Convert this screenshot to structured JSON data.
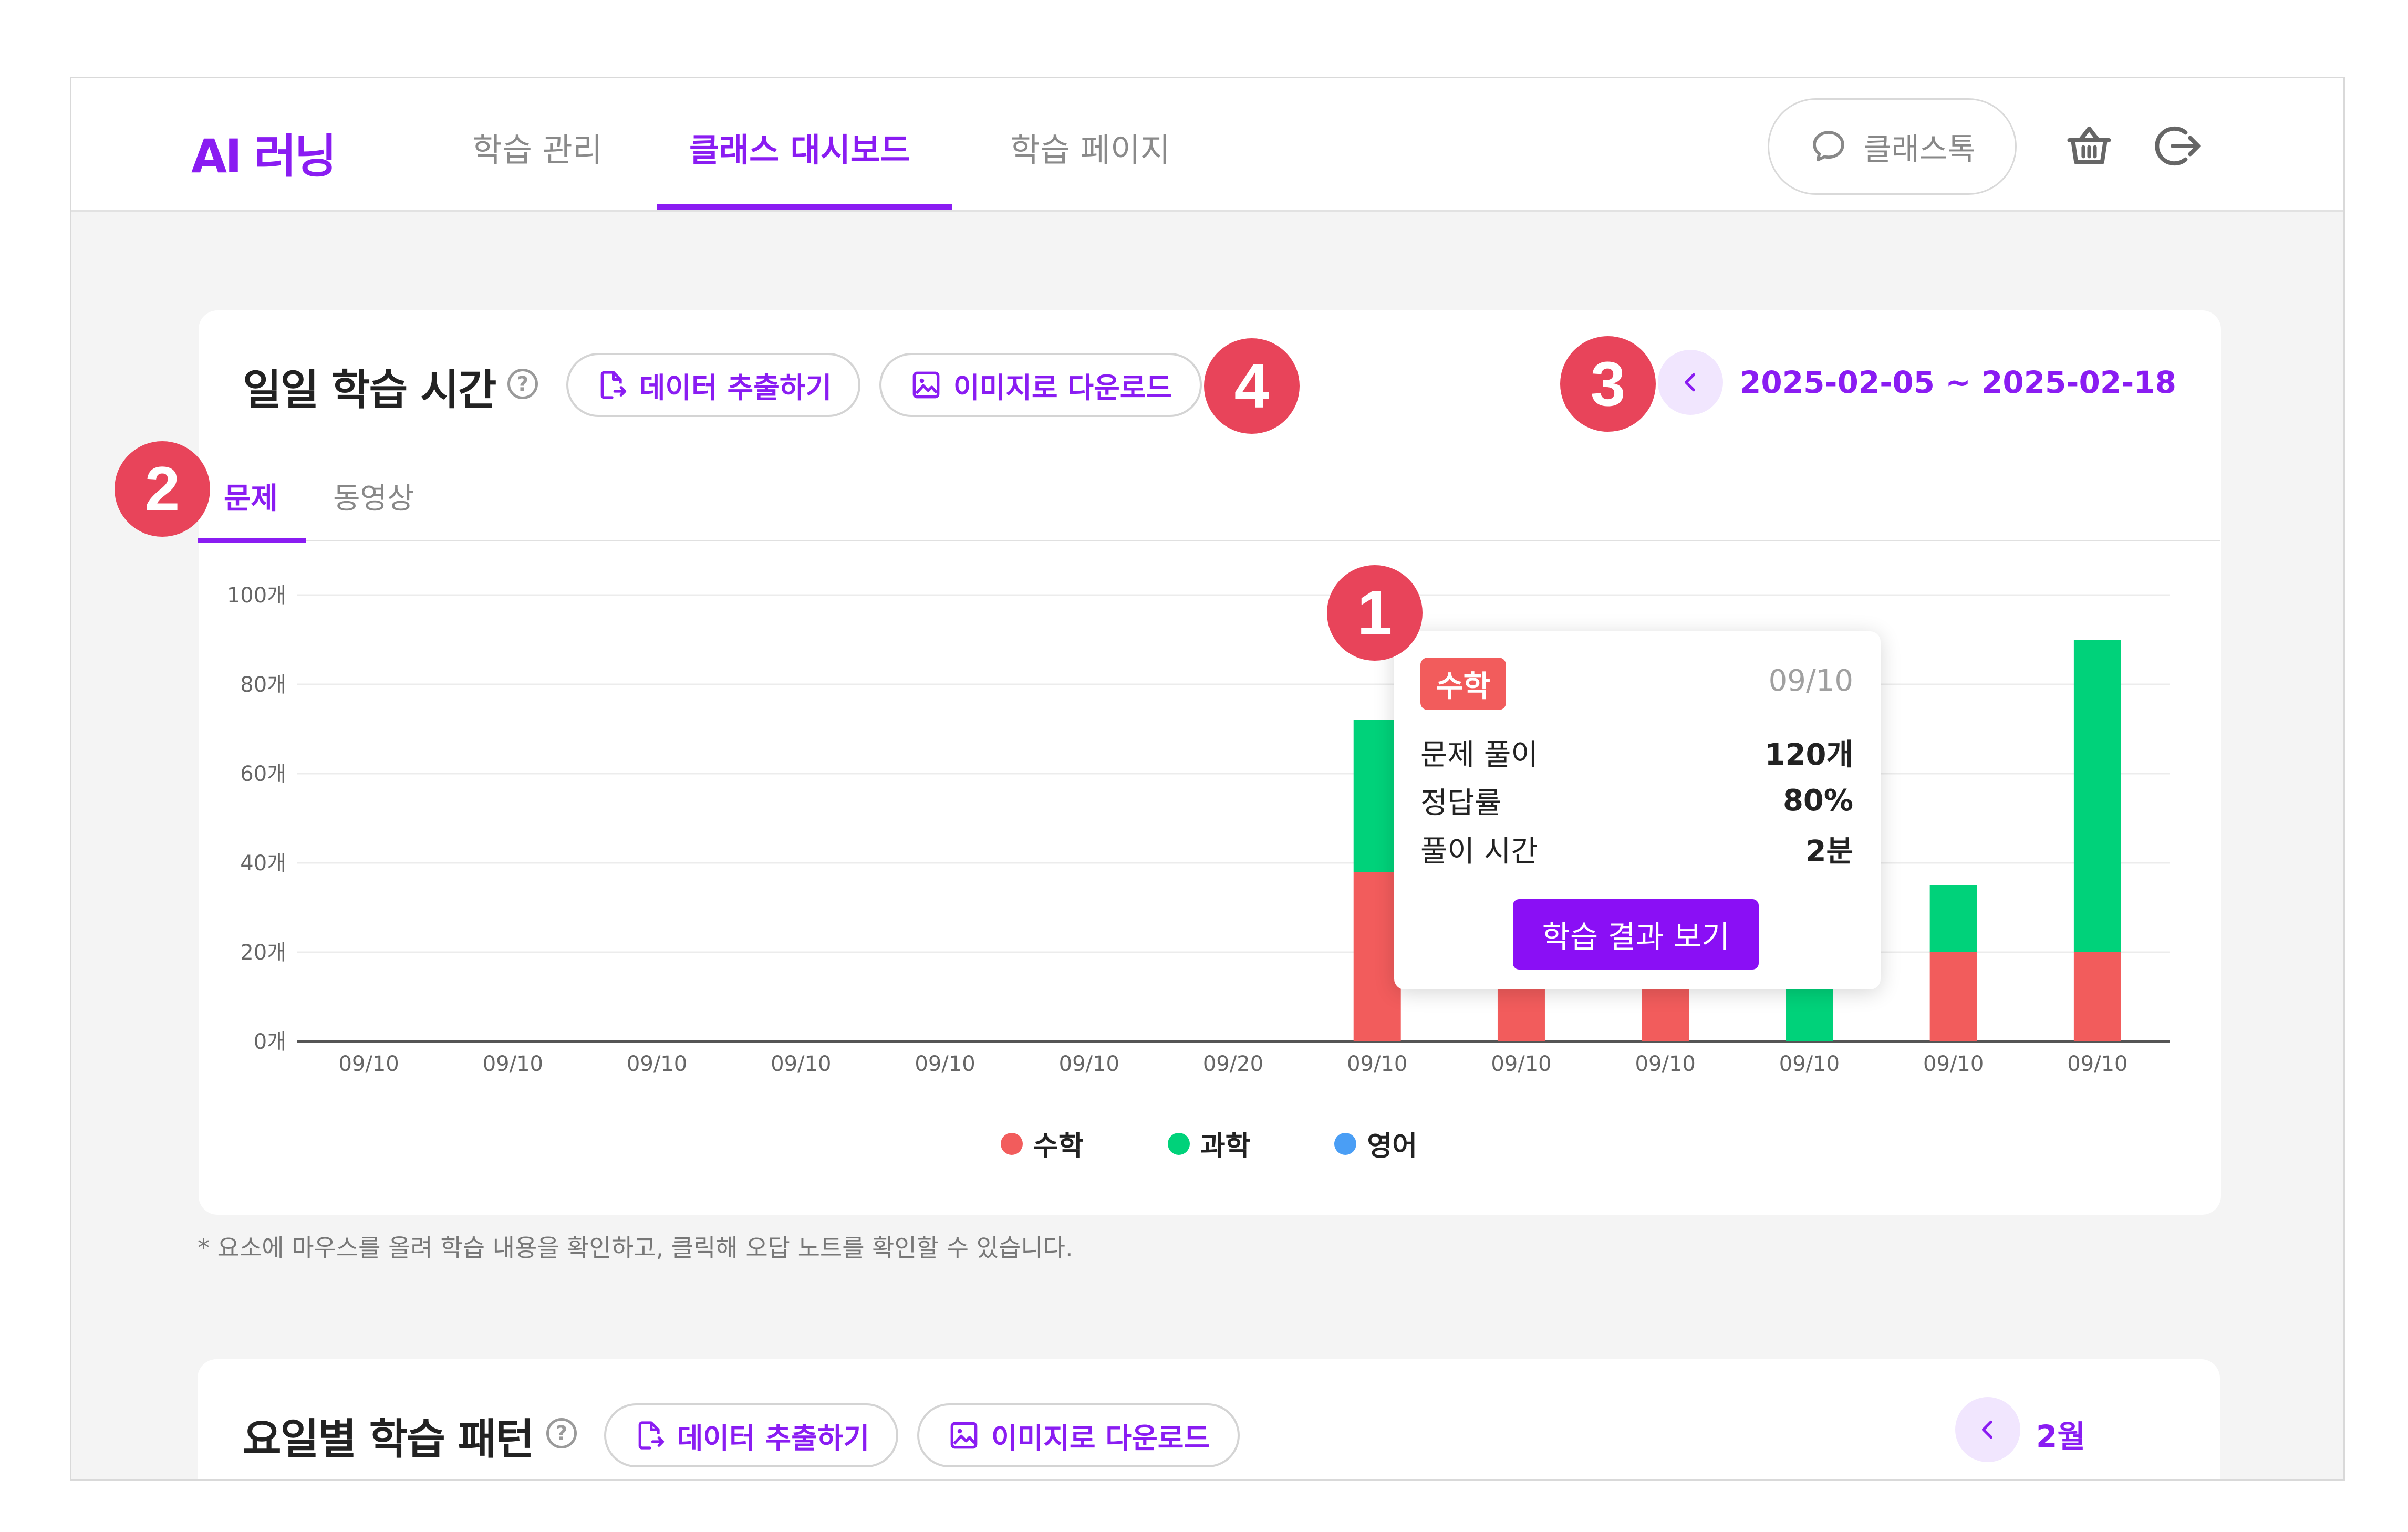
{
  "header": {
    "logo": "AI 러닝",
    "tabs": [
      {
        "label": "학습 관리"
      },
      {
        "label": "클래스 대시보드"
      },
      {
        "label": "학습 페이지"
      }
    ],
    "active_tab": "클래스 대시보드",
    "talk_button": "클래스톡",
    "icons": [
      "chat-bubble-icon",
      "basket-icon",
      "logout-icon"
    ]
  },
  "daily_card": {
    "title": "일일 학습 시간",
    "export_button": "데이터 추출하기",
    "download_button": "이미지로 다운로드",
    "date_range": "2025-02-05 ~ 2025-02-18",
    "tabs": [
      "문제",
      "동영상"
    ],
    "active_tab": "문제"
  },
  "chart_data": {
    "type": "bar",
    "stacked": true,
    "categories": [
      "09/10",
      "09/10",
      "09/10",
      "09/10",
      "09/10",
      "09/10",
      "09/20",
      "09/10",
      "09/10",
      "09/10",
      "09/10",
      "09/10",
      "09/10"
    ],
    "series": [
      {
        "name": "수학",
        "color": "#f25c5c",
        "values": [
          0,
          0,
          0,
          0,
          0,
          0,
          0,
          38,
          20,
          20,
          0,
          20,
          20
        ]
      },
      {
        "name": "과학",
        "color": "#00d27a",
        "values": [
          0,
          0,
          0,
          0,
          0,
          0,
          0,
          34,
          0,
          0,
          20,
          15,
          70
        ]
      },
      {
        "name": "영어",
        "color": "#4a9ef5",
        "values": [
          0,
          0,
          0,
          0,
          0,
          0,
          0,
          0,
          0,
          0,
          0,
          0,
          0
        ]
      }
    ],
    "y_ticks": [
      "0개",
      "20개",
      "40개",
      "60개",
      "80개",
      "100개"
    ],
    "ylim": [
      0,
      100
    ],
    "grid": true,
    "legend_position": "bottom-center"
  },
  "tooltip": {
    "subject": "수학",
    "date": "09/10",
    "rows": [
      {
        "label": "문제 풀이",
        "value": "120개"
      },
      {
        "label": "정답률",
        "value": "80%"
      },
      {
        "label": "풀이 시간",
        "value": "2분"
      }
    ],
    "button": "학습 결과 보기"
  },
  "footnote": "* 요소에 마우스를 올려 학습 내용을 확인하고, 클릭해 오답 노트를 확인할 수 있습니다.",
  "weekly_card": {
    "title": "요일별 학습 패턴",
    "export_button": "데이터 추출하기",
    "download_button": "이미지로 다운로드",
    "month": "2월"
  },
  "markers": [
    "1",
    "2",
    "3",
    "4"
  ],
  "colors": {
    "accent": "#8a1cf2",
    "marker": "#e8445a",
    "math": "#f25c5c",
    "science": "#00d27a",
    "english": "#4a9ef5"
  }
}
